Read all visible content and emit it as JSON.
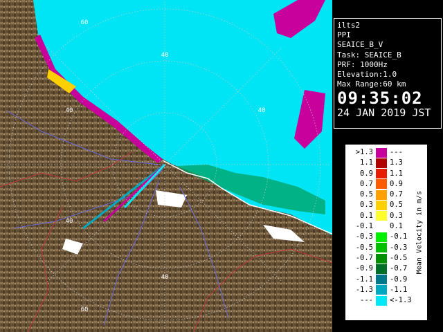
{
  "radar": {
    "range_labels": [
      "60",
      "40",
      "40",
      "40",
      "40",
      "40",
      "60"
    ],
    "colors": {
      "land_dark": "#5a4630",
      "land_light": "#a08a68",
      "sea_echo": "#00e5f5",
      "river": "#6a6ad8",
      "boundary": "#c03838",
      "coast": "#ffffff",
      "ring": "#c8c8c8"
    }
  },
  "info": {
    "site": "ilts2",
    "product": "PPI",
    "name": "SEAICE_B_V",
    "task": "Task: SEAICE_B",
    "prf": "PRF: 1000Hz",
    "elevation": "Elevation:1.0",
    "max_range": "Max Range:60 km",
    "time": "09:35:02",
    "date": "24 JAN 2019 JST"
  },
  "legend": {
    "title": "Mean Velocity in m/s",
    "rows": [
      {
        "lo": ">1.3",
        "hi": "---",
        "color": "#c8009c"
      },
      {
        "lo": "1.1",
        "hi": "1.3",
        "color": "#b00000"
      },
      {
        "lo": "0.9",
        "hi": "1.1",
        "color": "#e81c00"
      },
      {
        "lo": "0.7",
        "hi": "0.9",
        "color": "#ff5c00"
      },
      {
        "lo": "0.5",
        "hi": "0.7",
        "color": "#ffa000"
      },
      {
        "lo": "0.3",
        "hi": "0.5",
        "color": "#ffd000"
      },
      {
        "lo": "0.1",
        "hi": "0.3",
        "color": "#ffff30"
      },
      {
        "lo": "-0.1",
        "hi": "0.1",
        "color": "#ffffff"
      },
      {
        "lo": "-0.3",
        "hi": "-0.1",
        "color": "#00f000"
      },
      {
        "lo": "-0.5",
        "hi": "-0.3",
        "color": "#00c000"
      },
      {
        "lo": "-0.7",
        "hi": "-0.5",
        "color": "#009000"
      },
      {
        "lo": "-0.9",
        "hi": "-0.7",
        "color": "#007028"
      },
      {
        "lo": "-1.1",
        "hi": "-0.9",
        "color": "#00788c"
      },
      {
        "lo": "-1.3",
        "hi": "-1.1",
        "color": "#00a8c0"
      },
      {
        "lo": "---",
        "hi": "<-1.3",
        "color": "#00e8f8"
      }
    ]
  }
}
